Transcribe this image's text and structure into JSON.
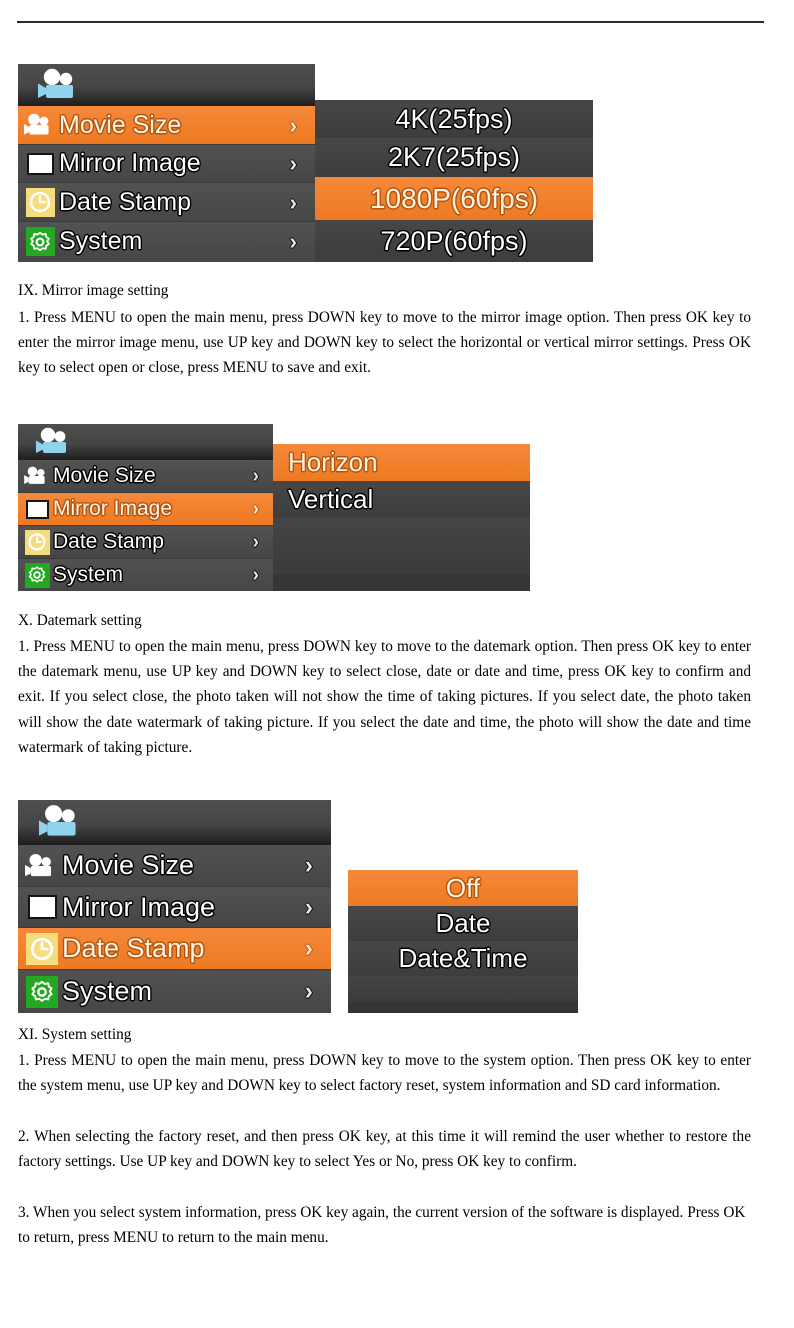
{
  "document": {
    "sections": [
      {
        "heading": "IX. Mirror image setting",
        "paragraphs": [
          "1. Press MENU to open the main menu, press DOWN key to move to the mirror image option. Then press OK key to enter the mirror image menu, use UP key and DOWN key to select the horizontal or vertical mirror settings. Press OK key to select open or close, press MENU to save and exit."
        ]
      },
      {
        "heading": "X. Datemark setting",
        "paragraphs": [
          "1. Press MENU to open the main menu, press DOWN key to move to the datemark option. Then press OK key to enter the datemark menu, use UP key and DOWN key to select close, date or date and time, press OK key to confirm and exit. If you select close, the photo taken will not show the time of taking pictures. If you select date, the photo taken will show the date watermark of taking picture. If you select the date and time, the photo will show the date and time watermark of taking picture."
        ]
      },
      {
        "heading": "XI. System setting",
        "paragraphs": [
          "1. Press MENU to open the main menu, press DOWN key to move to the system option. Then press OK key to enter the system menu, use UP key and DOWN key to select factory reset, system information and SD card information.",
          "2. When selecting the factory reset, and then press OK key, at this time it will remind the user whether to restore the factory settings. Use UP key and DOWN key to select Yes or No, press OK key to confirm.",
          "3. When you select system information, press OK key again, the current version of the software is displayed. Press OK to return, press MENU to return to the main menu."
        ]
      }
    ]
  },
  "colors": {
    "accent_orange": "#ee7a22",
    "menu_gray": "#4a4a4a",
    "panel_gray": "#3f3f3f",
    "header_dark": "#1e1e1e",
    "clock_chip": "#f5dd7e",
    "gear_chip": "#22a821",
    "camera_icon_blue": "#8fd3ec"
  },
  "menus": {
    "movie_size": {
      "header_icon": "video-camera-icon",
      "items": [
        {
          "label": "Movie Size",
          "icon": "video-camera-icon",
          "selected": true,
          "arrow": "›"
        },
        {
          "label": "Mirror Image",
          "icon": "mirror-square-icon",
          "selected": false,
          "arrow": "›"
        },
        {
          "label": "Date Stamp",
          "icon": "clock-icon",
          "selected": false,
          "arrow": "›"
        },
        {
          "label": "System",
          "icon": "gear-icon",
          "selected": false,
          "arrow": "›"
        }
      ],
      "options": [
        {
          "label": "4K(25fps)",
          "selected": false
        },
        {
          "label": "2K7(25fps)",
          "selected": false
        },
        {
          "label": "1080P(60fps)",
          "selected": true
        },
        {
          "label": "720P(60fps)",
          "selected": false
        }
      ]
    },
    "mirror_image": {
      "header_icon": "video-camera-icon",
      "items": [
        {
          "label": "Movie Size",
          "icon": "video-camera-icon",
          "selected": false,
          "arrow": "›"
        },
        {
          "label": "Mirror Image",
          "icon": "mirror-square-icon",
          "selected": true,
          "arrow": "›"
        },
        {
          "label": "Date Stamp",
          "icon": "clock-icon",
          "selected": false,
          "arrow": "›"
        },
        {
          "label": "System",
          "icon": "gear-icon",
          "selected": false,
          "arrow": "›"
        }
      ],
      "options": [
        {
          "label": "Horizon",
          "selected": true
        },
        {
          "label": "Vertical",
          "selected": false
        }
      ]
    },
    "date_stamp": {
      "header_icon": "video-camera-icon",
      "items": [
        {
          "label": "Movie Size",
          "icon": "video-camera-icon",
          "selected": false,
          "arrow": "›"
        },
        {
          "label": "Mirror Image",
          "icon": "mirror-square-icon",
          "selected": false,
          "arrow": "›"
        },
        {
          "label": "Date Stamp",
          "icon": "clock-icon",
          "selected": true,
          "arrow": "›"
        },
        {
          "label": "System",
          "icon": "gear-icon",
          "selected": false,
          "arrow": "›"
        }
      ],
      "options": [
        {
          "label": "Off",
          "selected": true
        },
        {
          "label": "Date",
          "selected": false
        },
        {
          "label": "Date&Time",
          "selected": false
        }
      ]
    }
  }
}
